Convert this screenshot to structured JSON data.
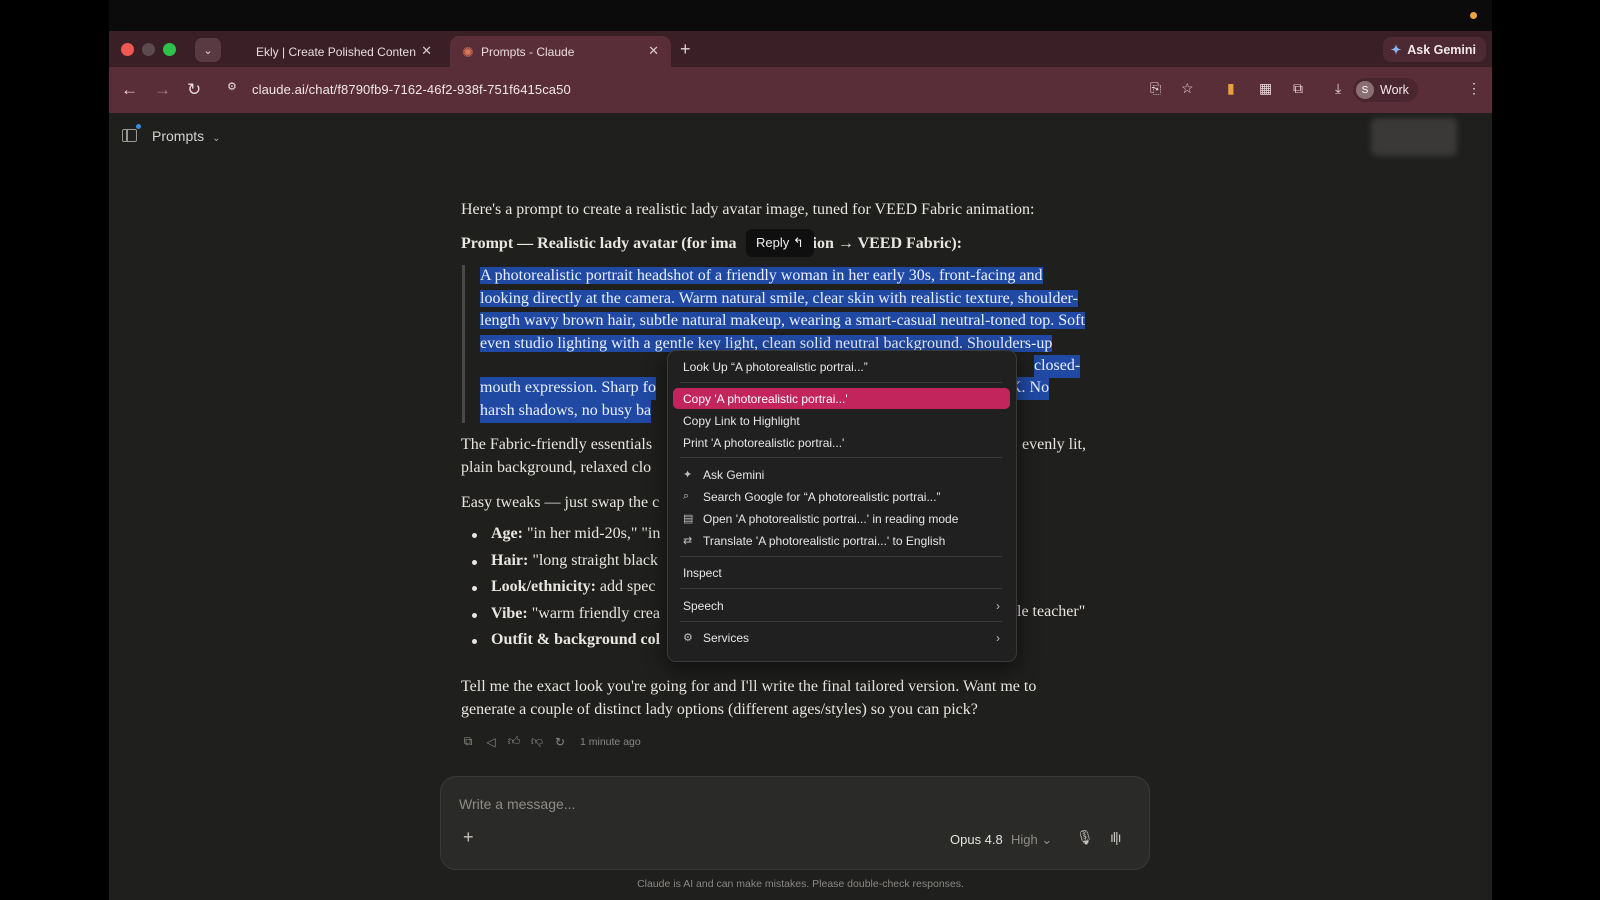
{
  "browser": {
    "tabs": [
      {
        "label": "Ekly | Create Polished Conten",
        "close": "✕"
      },
      {
        "label": "Prompts - Claude",
        "close": "✕"
      }
    ],
    "new_tab": "+",
    "ask_gemini": "Ask Gemini",
    "url": "claude.ai/chat/f8790fb9-7162-46f2-938f-751f6415ca50",
    "profile_initial": "S",
    "profile_name": "Work"
  },
  "page": {
    "project_name": "Prompts",
    "intro": "Here's a prompt to create a realistic lady avatar image, tuned for VEED Fabric animation:",
    "prompt_heading_left": "Prompt — Realistic lady avatar (for ima",
    "prompt_heading_right": "ion → VEED Fabric):",
    "reply_chip": "Reply ↰",
    "quote": "A photorealistic portrait headshot of a friendly woman in her early 30s, front-facing and looking directly at the camera. Warm natural smile, clear skin with realistic texture, shoulder-length wavy brown hair, subtle natural makeup, wearing a smart-casual neutral-toned top. Soft even studio lighting with a gentle key light, clean solid neutral background. Shoulders-up",
    "quote_line6_right": "closed-",
    "quote_line7_left": "mouth expression. Sharp fo",
    "quote_line7_right": "K. No",
    "quote_line8_left": "harsh shadows, no busy ba",
    "para2_left": "The Fabric-friendly essentials",
    "para2_right": "evenly lit,",
    "para2_line2": "plain background, relaxed clo",
    "para3": "Easy tweaks — just swap the c",
    "bullets": [
      {
        "label": "Age:",
        "text": " \"in her mid-20s,\" \"in"
      },
      {
        "label": "Hair:",
        "text": " \"long straight black"
      },
      {
        "label": "Look/ethnicity:",
        "text": " add spec"
      },
      {
        "label": "Vibe:",
        "text": " \"warm friendly crea"
      },
      {
        "label": "Outfit & background col",
        "text": ""
      }
    ],
    "bullet_vibe_right": "le teacher\"",
    "closing": "Tell me the exact look you're going for and I'll write the final tailored version. Want me to generate a couple of distinct lady options (different ages/styles) so you can pick?",
    "timestamp": "1 minute ago"
  },
  "context_menu": {
    "look_up": "Look Up “A photorealistic portrai...”",
    "copy": "Copy 'A photorealistic portrai...'",
    "copy_link": "Copy Link to Highlight",
    "print": "Print 'A photorealistic portrai...'",
    "ask_gemini": "Ask Gemini",
    "search_google": "Search Google for “A photorealistic portrai...”",
    "reading_mode": "Open 'A photorealistic portrai...' in reading mode",
    "translate": "Translate 'A photorealistic portrai...' to English",
    "inspect": "Inspect",
    "speech": "Speech",
    "services": "Services"
  },
  "composer": {
    "placeholder": "Write a message...",
    "model": "Opus 4.8",
    "effort": "High ⌄",
    "disclaimer": "Claude is AI and can make mistakes. Please double-check responses."
  },
  "colors": {
    "tab_strip": "#3a1f26",
    "toolbar": "#5a2e38",
    "selection": "#2049a3",
    "menu_highlight": "#c2245c",
    "page_bg": "#1f1f1e"
  }
}
